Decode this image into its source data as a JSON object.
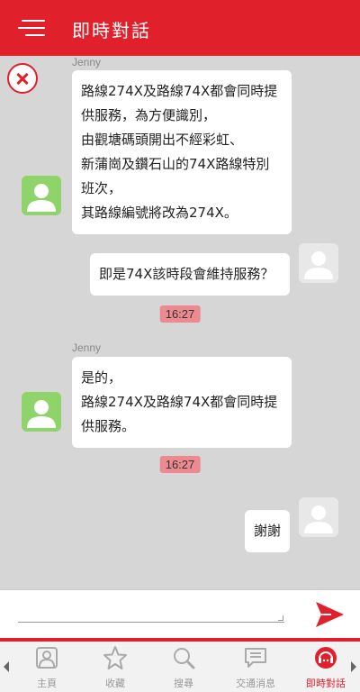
{
  "header": {
    "title": "即時對話",
    "menu_icon": "hamburger-menu-icon"
  },
  "chat": {
    "close_icon": "close-icon",
    "messages": [
      {
        "sender": "Jenny",
        "text": "路線274X及路線74X都會同時提\n供服務，為方便識別，\n由觀塘碼頭開出不經彩虹、\n新蒲崗及鑽石山的74X路線特別\n班次，\n其路線編號將改為274X。"
      },
      {
        "text": "即是74X該時段會維持服務？"
      },
      {
        "time": "16:27"
      },
      {
        "sender": "Jenny",
        "text": "是的，\n路線274X及路線74X都會同時提\n供服務。"
      },
      {
        "time": "16:27"
      },
      {
        "text": "謝謝"
      }
    ]
  },
  "input": {
    "value": "",
    "send_icon": "send-icon"
  },
  "nav": {
    "items": [
      {
        "label": "主頁",
        "icon": "home-icon"
      },
      {
        "label": "收藏",
        "icon": "star-icon"
      },
      {
        "label": "搜尋",
        "icon": "search-icon"
      },
      {
        "label": "交通消息",
        "icon": "message-icon"
      },
      {
        "label": "即時對話",
        "icon": "live-chat-icon",
        "active": true
      }
    ]
  },
  "colors": {
    "brand": "#e0202a",
    "time_badge": "#ec8a8f",
    "agent_avatar": "#8fd46a"
  }
}
